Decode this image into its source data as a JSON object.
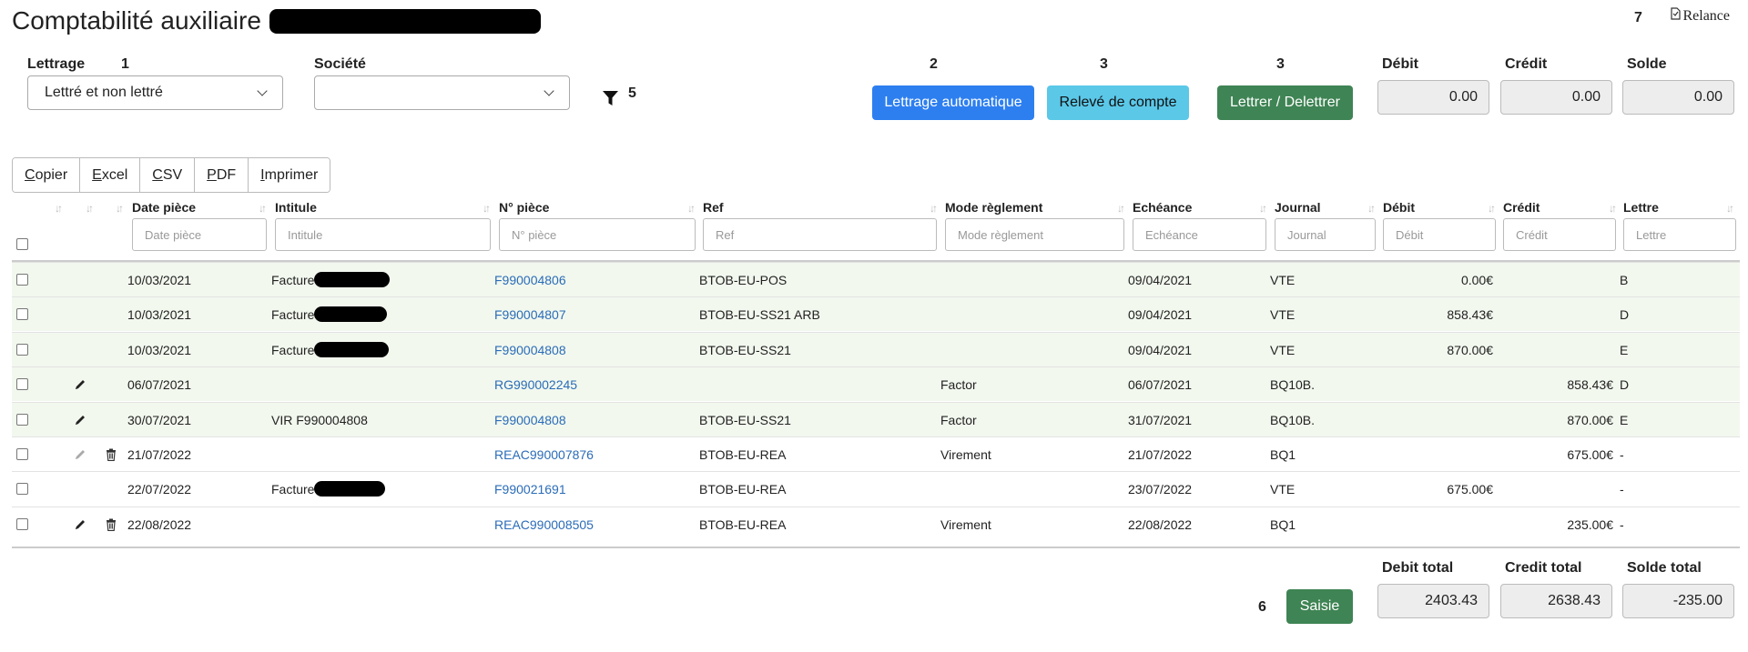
{
  "header": {
    "title": "Comptabilité auxiliaire - ",
    "relance_label": "Relance",
    "step_numbers": {
      "n1": "1",
      "n2": "2",
      "n3a": "3",
      "n3b": "3",
      "n5": "5",
      "n6": "6",
      "n7": "7"
    }
  },
  "filters": {
    "lettrage_label": "Lettrage",
    "lettrage_value": "Lettré et non lettré",
    "societe_label": "Société",
    "societe_value": ""
  },
  "actions": {
    "lettrage_auto": "Lettrage automatique",
    "releve": "Relevé de compte",
    "lettrer": "Lettrer / Delettrer",
    "saisie": "Saisie"
  },
  "summary": {
    "debit_label": "Débit",
    "debit_value": "0.00",
    "credit_label": "Crédit",
    "credit_value": "0.00",
    "solde_label": "Solde",
    "solde_value": "0.00"
  },
  "export": {
    "copier": "Copier",
    "excel": "Excel",
    "csv": "CSV",
    "pdf": "PDF",
    "imprimer": "Imprimer"
  },
  "table": {
    "headers": {
      "date": "Date pièce",
      "intitule": "Intitule",
      "piece": "N° pièce",
      "ref": "Ref",
      "mode": "Mode règlement",
      "echeance": "Echéance",
      "journal": "Journal",
      "debit": "Débit",
      "credit": "Crédit",
      "lettre": "Lettre"
    },
    "placeholders": {
      "date": "Date pièce",
      "intitule": "Intitule",
      "piece": "N° pièce",
      "ref": "Ref",
      "mode": "Mode règlement",
      "echeance": "Echéance",
      "journal": "Journal",
      "debit": "Débit",
      "credit": "Crédit",
      "lettre": "Lettre"
    },
    "rows": [
      {
        "date": "10/03/2021",
        "intitule": "Facture",
        "piece": "F990004806",
        "ref": "BTOB-EU-POS",
        "mode": "",
        "echeance": "09/04/2021",
        "journal": "VTE",
        "debit": "0.00€",
        "credit": "",
        "lettre": "B"
      },
      {
        "date": "10/03/2021",
        "intitule": "Facture",
        "piece": "F990004807",
        "ref": "BTOB-EU-SS21 ARB",
        "mode": "",
        "echeance": "09/04/2021",
        "journal": "VTE",
        "debit": "858.43€",
        "credit": "",
        "lettre": "D"
      },
      {
        "date": "10/03/2021",
        "intitule": "Facture",
        "piece": "F990004808",
        "ref": "BTOB-EU-SS21",
        "mode": "",
        "echeance": "09/04/2021",
        "journal": "VTE",
        "debit": "870.00€",
        "credit": "",
        "lettre": "E"
      },
      {
        "date": "06/07/2021",
        "intitule": "",
        "piece": "RG990002245",
        "ref": "",
        "mode": "Factor",
        "echeance": "06/07/2021",
        "journal": "BQ10B.",
        "debit": "",
        "credit": "858.43€",
        "lettre": "D"
      },
      {
        "date": "30/07/2021",
        "intitule": "VIR F990004808",
        "piece": "F990004808",
        "ref": "BTOB-EU-SS21",
        "mode": "Factor",
        "echeance": "31/07/2021",
        "journal": "BQ10B.",
        "debit": "",
        "credit": "870.00€",
        "lettre": "E"
      },
      {
        "date": "21/07/2022",
        "intitule": "",
        "piece": "REAC990007876",
        "ref": "BTOB-EU-REA",
        "mode": "Virement",
        "echeance": "21/07/2022",
        "journal": "BQ1",
        "debit": "",
        "credit": "675.00€",
        "lettre": "-"
      },
      {
        "date": "22/07/2022",
        "intitule": "Facture",
        "piece": "F990021691",
        "ref": "BTOB-EU-REA",
        "mode": "",
        "echeance": "23/07/2022",
        "journal": "VTE",
        "debit": "675.00€",
        "credit": "",
        "lettre": "-"
      },
      {
        "date": "22/08/2022",
        "intitule": "",
        "piece": "REAC990008505",
        "ref": "BTOB-EU-REA",
        "mode": "Virement",
        "echeance": "22/08/2022",
        "journal": "BQ1",
        "debit": "",
        "credit": "235.00€",
        "lettre": "-"
      }
    ]
  },
  "totals": {
    "debit_label": "Debit total",
    "debit_value": "2403.43",
    "credit_label": "Credit total",
    "credit_value": "2638.43",
    "solde_label": "Solde total",
    "solde_value": "-235.00"
  },
  "colors": {
    "primary": "#2d7ff0",
    "info": "#5bc8e8",
    "success": "#3f8454",
    "link": "#2b6cb8",
    "row_green": "#f2f8ee"
  }
}
